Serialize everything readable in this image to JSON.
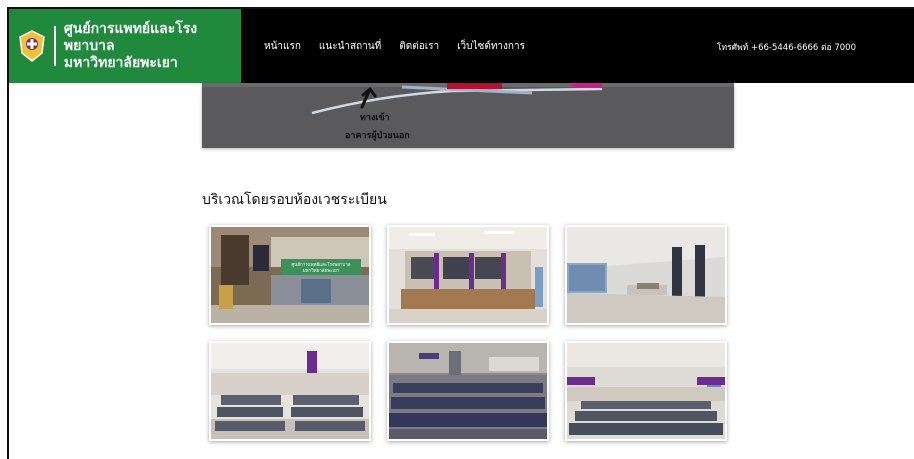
{
  "header": {
    "brand_line1": "ศูนย์การแพทย์และโรงพยาบาล",
    "brand_line2": "มหาวิทยาลัยพะเยา",
    "nav": [
      {
        "label": "หน้าแรก"
      },
      {
        "label": "แนะนำสถานที่"
      },
      {
        "label": "ติดต่อเรา"
      },
      {
        "label": "เว็บไซต์ทางการ"
      }
    ],
    "phone": "โทรศัพท์ +66-5446-6666 ต่อ 7000"
  },
  "map": {
    "entrance_label": "ทางเข้า",
    "building_label": "อาคารผู้ป่วยนอก"
  },
  "section": {
    "title": "บริเวณโดยรอบห้องเวชระเบียน",
    "sign_line1": "ศูนย์การแพทย์และโรงพยาบาล",
    "sign_line2": "มหาวิทยาลัยพะเยา"
  },
  "colors": {
    "brand_green": "#1f8a3c",
    "header_black": "#000000",
    "accent_purple": "#6a2d8f"
  }
}
